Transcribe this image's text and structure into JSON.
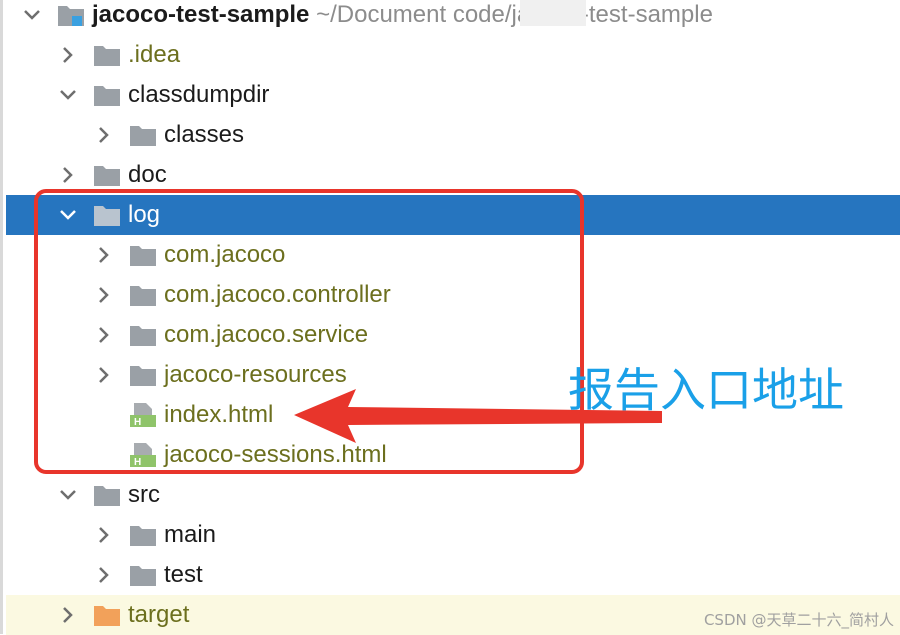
{
  "project": {
    "name": "jacoco-test-sample",
    "path": "~/Document        code/jacoco-test-sample"
  },
  "tree": {
    "items": [
      {
        "label": ".idea"
      },
      {
        "label": "classdumpdir"
      },
      {
        "label": "classes"
      },
      {
        "label": "doc"
      },
      {
        "label": "log"
      },
      {
        "label": "com.jacoco"
      },
      {
        "label": "com.jacoco.controller"
      },
      {
        "label": "com.jacoco.service"
      },
      {
        "label": "jacoco-resources"
      },
      {
        "label": "index.html"
      },
      {
        "label": "jacoco-sessions.html"
      },
      {
        "label": "src"
      },
      {
        "label": "main"
      },
      {
        "label": "test"
      },
      {
        "label": "target"
      }
    ]
  },
  "annotation": {
    "text": "报告入口地址",
    "color": "#1aa0e8",
    "arrow_color": "#e8352b"
  },
  "watermark": "CSDN @天草二十六_简村人",
  "colors": {
    "selection": "#2675bf",
    "folder": "#9aa0a6",
    "excluded_folder": "#f2a15a",
    "olive_text": "#6c6f1e",
    "highlight_border": "#e8352b"
  },
  "icons": {
    "chevron_right": "chevron-right-icon",
    "chevron_down": "chevron-down-icon",
    "folder": "folder-icon",
    "html_file": "html-file-icon",
    "module": "module-icon"
  }
}
